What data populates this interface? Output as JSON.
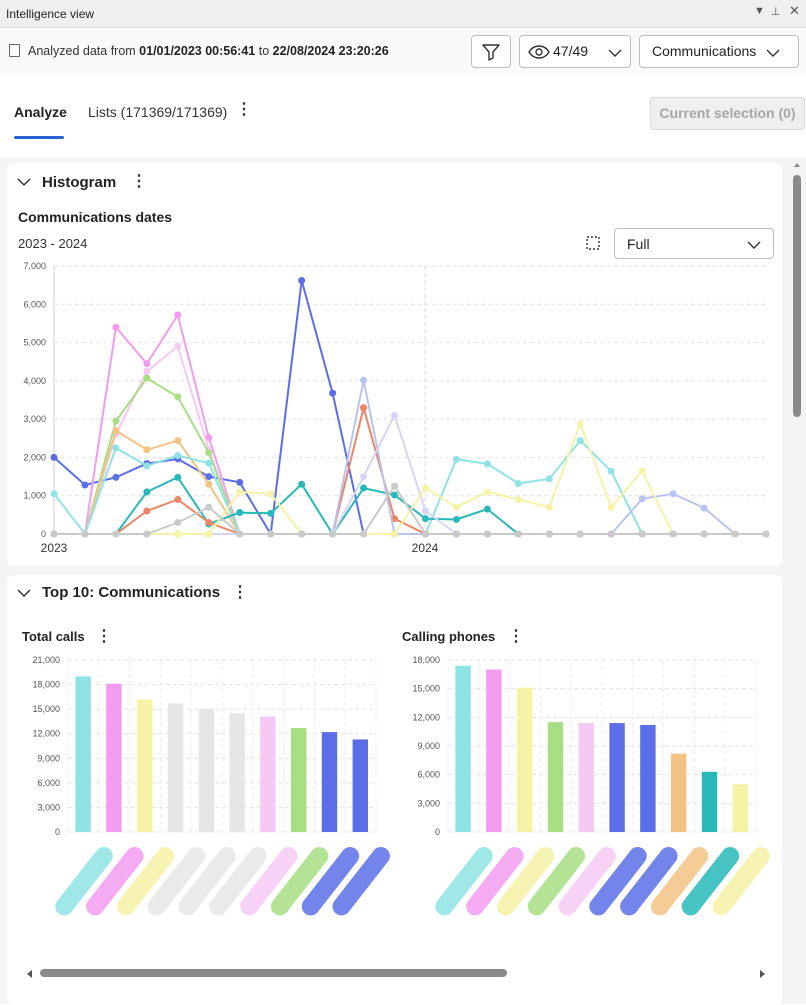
{
  "window": {
    "title": "Intelligence view"
  },
  "toolbar": {
    "range_prefix": "Analyzed data from ",
    "range_start": "01/01/2023 00:56:41",
    "range_mid": " to ",
    "range_end": "22/08/2024 23:20:26",
    "visible_count": "47/49",
    "view_select": "Communications"
  },
  "tabs": [
    {
      "label": "Analyze",
      "active": true
    },
    {
      "label": "Lists (171369/171369)",
      "active": false
    }
  ],
  "current_selection_label": "Current selection (0)",
  "histogram": {
    "section_title": "Histogram",
    "chart_title": "Communications dates",
    "year_range": "2023 - 2024",
    "granularity": "Full"
  },
  "top10": {
    "section_title": "Top 10: Communications"
  },
  "icons": [
    "filter-icon",
    "eye-icon",
    "chevron-down-icon",
    "kebab-icon",
    "selection-icon",
    "doc-icon"
  ],
  "chart_data": [
    {
      "type": "line",
      "title": "Communications dates",
      "ylim": [
        0,
        7000
      ],
      "yticks": [
        "0",
        "1,000",
        "2,000",
        "3,000",
        "4,000",
        "5,000",
        "6,000",
        "7,000"
      ],
      "xticks": [
        "2023",
        "2024"
      ],
      "grid": true,
      "series": [
        {
          "color": "#5b6ee8",
          "values": [
            2000,
            1280,
            1480,
            1840,
            1960,
            1500,
            1350,
            0,
            6620,
            3680,
            0,
            0,
            0,
            0,
            0,
            0,
            0,
            0,
            0,
            0,
            0,
            0,
            0,
            0
          ]
        },
        {
          "color": "#f29cf0",
          "values": [
            0,
            0,
            5400,
            4450,
            5720,
            2520,
            0,
            0,
            0,
            0,
            0,
            0,
            0,
            0,
            0,
            0,
            0,
            0,
            0,
            0,
            0,
            0,
            0,
            0
          ]
        },
        {
          "color": "#f6c9f5",
          "values": [
            0,
            0,
            2600,
            4250,
            4900,
            2200,
            0,
            0,
            0,
            0,
            0,
            0,
            0,
            0,
            0,
            0,
            0,
            0,
            0,
            0,
            0,
            0,
            0,
            0
          ]
        },
        {
          "color": "#a7de82",
          "values": [
            0,
            0,
            2950,
            4070,
            3580,
            2120,
            0,
            0,
            0,
            0,
            0,
            0,
            0,
            0,
            0,
            0,
            0,
            0,
            0,
            0,
            0,
            0,
            0,
            0
          ]
        },
        {
          "color": "#f3c383",
          "values": [
            0,
            0,
            2700,
            2200,
            2440,
            1300,
            0,
            0,
            0,
            0,
            0,
            0,
            0,
            0,
            0,
            0,
            0,
            0,
            0,
            0,
            0,
            0,
            0,
            0
          ]
        },
        {
          "color": "#8fe3e4",
          "values": [
            1050,
            0,
            2250,
            1780,
            2050,
            1850,
            0,
            0,
            0,
            0,
            0,
            0,
            0,
            1950,
            1830,
            1320,
            1440,
            2440,
            1640,
            0,
            0,
            0,
            0,
            0
          ]
        },
        {
          "color": "#28b8b8",
          "values": [
            0,
            0,
            0,
            1100,
            1480,
            260,
            560,
            540,
            1300,
            0,
            1200,
            1020,
            400,
            380,
            650,
            0,
            0,
            0,
            0,
            0,
            0,
            0,
            0,
            0
          ]
        },
        {
          "color": "#ec8566",
          "values": [
            0,
            0,
            0,
            600,
            900,
            300,
            0,
            0,
            0,
            0,
            3300,
            400,
            0,
            0,
            0,
            0,
            0,
            0,
            0,
            0,
            0,
            0,
            0,
            0
          ]
        },
        {
          "color": "#b8c4ef",
          "values": [
            0,
            0,
            0,
            0,
            0,
            0,
            0,
            0,
            0,
            0,
            4020,
            0,
            0,
            0,
            0,
            0,
            0,
            0,
            0,
            920,
            1050,
            680,
            0,
            0
          ]
        },
        {
          "color": "#d9d4f2",
          "values": [
            0,
            0,
            0,
            0,
            0,
            0,
            0,
            0,
            0,
            0,
            1500,
            3100,
            600,
            0,
            0,
            0,
            0,
            0,
            0,
            0,
            0,
            0,
            0,
            0
          ]
        },
        {
          "color": "#f6f2a6",
          "values": [
            0,
            0,
            0,
            0,
            0,
            0,
            1100,
            1050,
            0,
            0,
            0,
            0,
            1200,
            700,
            1100,
            900,
            700,
            2880,
            700,
            1650,
            0,
            0,
            0,
            0
          ]
        },
        {
          "color": "#c9c9c9",
          "values": [
            0,
            0,
            0,
            0,
            300,
            700,
            0,
            0,
            0,
            0,
            0,
            1250,
            0,
            0,
            0,
            0,
            0,
            0,
            0,
            0,
            0,
            0,
            0,
            0
          ]
        }
      ]
    },
    {
      "type": "bar",
      "title": "Total calls",
      "ylim": [
        0,
        21000
      ],
      "yticks": [
        "0",
        "3,000",
        "6,000",
        "9,000",
        "12,000",
        "15,000",
        "18,000",
        "21,000"
      ],
      "values": [
        19000,
        18100,
        16200,
        15700,
        15000,
        14500,
        14100,
        12700,
        12200,
        11300
      ],
      "colors": [
        "#8fe3e4",
        "#f29cf0",
        "#f6f2a6",
        "#e6e6e6",
        "#e6e6e6",
        "#e6e6e6",
        "#f6c9f5",
        "#a7de82",
        "#5b6ee8",
        "#5b6ee8"
      ]
    },
    {
      "type": "bar",
      "title": "Calling phones",
      "ylim": [
        0,
        18000
      ],
      "yticks": [
        "0",
        "3,000",
        "6,000",
        "9,000",
        "12,000",
        "15,000",
        "18,000"
      ],
      "values": [
        17400,
        17000,
        15100,
        11500,
        11400,
        11400,
        11200,
        8200,
        6300,
        5000
      ],
      "colors": [
        "#8fe3e4",
        "#f29cf0",
        "#f6f2a6",
        "#a7de82",
        "#f6c9f5",
        "#5b6ee8",
        "#5b6ee8",
        "#f3c383",
        "#28b8b8",
        "#f6f2a6"
      ]
    }
  ]
}
